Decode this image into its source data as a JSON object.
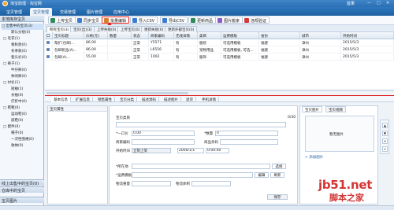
{
  "window": {
    "title": "淘宝助理 · 淘宝网",
    "controls": [
      "—",
      "□",
      "✕"
    ],
    "user": "蓝果"
  },
  "menu_tabs": [
    "宝贝管理",
    "宝贝管理",
    "交易管理",
    "图片管理",
    "应用中心"
  ],
  "sidebar": {
    "header": "本地库存宝贝",
    "items": [
      {
        "label": "□ 出售中的宝贝(3)",
        "level": 0
      },
      {
        "label": "默认分组(0)",
        "level": 2
      },
      {
        "label": "□ 毛衣(1)",
        "level": 1
      },
      {
        "label": "春秋款(0)",
        "level": 2
      },
      {
        "label": "冬季款(0)",
        "level": 2
      },
      {
        "label": "套头衫(0)",
        "level": 2
      },
      {
        "label": "□ 裤子(1)",
        "level": 1
      },
      {
        "label": "牛仔裤(0)",
        "level": 2
      },
      {
        "label": "休闲裤(0)",
        "level": 2
      },
      {
        "label": "□ 衬衫(1)",
        "level": 1
      },
      {
        "label": "短袖(1)",
        "level": 2
      },
      {
        "label": "长袖(0)",
        "level": 2
      },
      {
        "label": "打折中(0)",
        "level": 2
      },
      {
        "label": "□ 鞋靴(0)",
        "level": 1
      },
      {
        "label": "运动鞋(0)",
        "level": 2
      },
      {
        "label": "皮鞋(0)",
        "level": 2
      },
      {
        "label": "□ 配件(0)",
        "level": 1
      },
      {
        "label": "帽子(0)",
        "level": 2
      },
      {
        "label": "一次性围裙(0)",
        "level": 2
      },
      {
        "label": "收纳(0)",
        "level": 2
      }
    ],
    "footer_items": [
      "线上出售中的宝贝(0)",
      "仓库中的宝贝"
    ],
    "bottom": "宝贝图片"
  },
  "toolbar": {
    "buttons": [
      {
        "label": "上传宝贝",
        "color": "#2e8b57"
      },
      {
        "label": "同步宝贝",
        "color": "#3a7bd5"
      },
      {
        "label": "批量编辑",
        "color": "#d4822a"
      },
      {
        "label": "导入CSV",
        "color": "#3a7bd5"
      },
      {
        "label": "导出CSV",
        "color": "#3a7bd5"
      },
      {
        "label": "更新商品",
        "color": "#2e8b57"
      },
      {
        "label": "图片搬家",
        "color": "#8a5cc5"
      },
      {
        "label": "违规验证",
        "color": "#d43a3a"
      }
    ],
    "highlighted": "批量编辑"
  },
  "list_tabs": [
    "所有宝贝(3)",
    "宝贝(出)[3]",
    "上传失败(0)",
    "上传宝贝(0)",
    "更新失败(0)",
    "更新外部宝贝(0)"
  ],
  "grid": {
    "columns": [
      "",
      "宝贝标题",
      "价格(元)",
      "数量",
      "状态",
      "商家编码",
      "无线详情",
      "类目",
      "运费模板",
      "省份",
      "城市",
      "开始时间"
    ],
    "rows": [
      [
        "1",
        "帮扩(包邮)...",
        "86.00",
        "",
        "正常",
        "Y5571",
        "有",
        "服装",
        "可选用模板",
        "福建",
        "漳州",
        "2015/5/3"
      ],
      [
        "2",
        "包邮新品(A)...",
        "86.00",
        "",
        "正常",
        "L6556",
        "有",
        "宠物用品",
        "可选用模板, 可选...",
        "福建",
        "漳州",
        "2015/5/3"
      ],
      [
        "3",
        "包邮(A)...",
        "55.00",
        "",
        "正常",
        "1002",
        "有",
        "服饰",
        "可选用模板",
        "福建",
        "漳州",
        "2015/5/3"
      ]
    ]
  },
  "detail_tabs": [
    "基本信息",
    "扩展信息",
    "销售属性",
    "宝贝分类",
    "描述源码",
    "描述图片",
    "退货",
    "手机详情"
  ],
  "detail": {
    "attr_header": "宝贝属性",
    "title_label": "宝贝类目",
    "title_count": "0/30",
    "price_label": "*一口价",
    "price_value": "0.00",
    "qty_label": "*数量",
    "qty_value": "0",
    "code_label": "商家编码",
    "barcode_label": "商品条码",
    "start_label": "开始时间",
    "start_radio": "立刻上架",
    "start_date": "2000/1/1",
    "start_time": "0:00:00",
    "location_label": "*所在地",
    "select_btn": "选择",
    "shipping_label": "*运费模板",
    "edit_btn": "编辑",
    "refresh_btn": "刷新",
    "weight_label": "物流重量",
    "volume_label": "物流体积",
    "confirm_btn": "保存"
  },
  "right_panel": {
    "tabs": [
      "宝贝图片",
      "宝贝视频"
    ],
    "no_image": "暂无图片",
    "add_image": "+ 添加图片"
  },
  "watermark": {
    "line1": "jb51.net",
    "line2": "脚本之家"
  }
}
